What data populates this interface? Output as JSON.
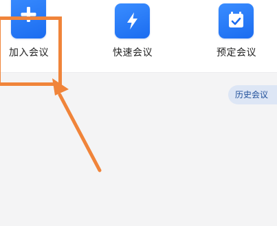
{
  "quick_actions": [
    {
      "label": "加入会议",
      "icon": "plus-icon"
    },
    {
      "label": "快速会议",
      "icon": "lightning-icon"
    },
    {
      "label": "预定会议",
      "icon": "calendar-check-icon"
    }
  ],
  "history": {
    "label": "历史会议"
  },
  "colors": {
    "accent": "#1b6cf0",
    "annotation": "#f0843a",
    "pill_bg": "#dde6f5"
  }
}
